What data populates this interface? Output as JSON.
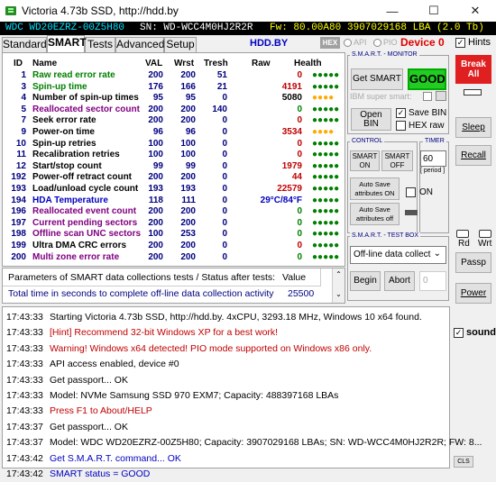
{
  "window": {
    "title": "Victoria 4.73b SSD, http://hdd.by",
    "min": "—",
    "max": "☐",
    "close": "✕"
  },
  "infobar": {
    "model": "WDC WD20EZRZ-00Z5H80",
    "sn": "SN: WD-WCC4M0HJ2R2R",
    "fw": "Fw: 80.00A80",
    "lba": "3907029168 LBA (2.0 Tb)"
  },
  "tabs": [
    "Standard",
    "SMART",
    "Tests",
    "Advanced",
    "Setup"
  ],
  "toolbar": {
    "hdd_by": "HDD.BY",
    "hex": "HEX",
    "api": "API",
    "pio": "PIO",
    "device": "Device 0",
    "hints": "Hints"
  },
  "smart_headers": {
    "id": "ID",
    "name": "Name",
    "val": "VAL",
    "wrst": "Wrst",
    "tresh": "Tresh",
    "raw": "Raw",
    "health": "Health"
  },
  "smart_rows": [
    {
      "id": "1",
      "name": "Raw read error rate",
      "val": "200",
      "wrst": "200",
      "tresh": "51",
      "raw": "0",
      "health": "●●●●●",
      "name_color": "#008000",
      "raw_color": "#c00000",
      "health_color": "#008000"
    },
    {
      "id": "3",
      "name": "Spin-up time",
      "val": "176",
      "wrst": "166",
      "tresh": "21",
      "raw": "4191",
      "health": "●●●●●",
      "name_color": "#008000",
      "raw_color": "#c00000",
      "health_color": "#008000"
    },
    {
      "id": "4",
      "name": "Number of spin-up times",
      "val": "95",
      "wrst": "95",
      "tresh": "0",
      "raw": "5080",
      "health": "●●●●",
      "name_color": "#000000",
      "raw_color": "#000000",
      "health_color": "#ffaa00"
    },
    {
      "id": "5",
      "name": "Reallocated sector count",
      "val": "200",
      "wrst": "200",
      "tresh": "140",
      "raw": "0",
      "health": "●●●●●",
      "name_color": "#800080",
      "raw_color": "#008000",
      "health_color": "#008000"
    },
    {
      "id": "7",
      "name": "Seek error rate",
      "val": "200",
      "wrst": "200",
      "tresh": "0",
      "raw": "0",
      "health": "●●●●●",
      "name_color": "#000000",
      "raw_color": "#c00000",
      "health_color": "#008000"
    },
    {
      "id": "9",
      "name": "Power-on time",
      "val": "96",
      "wrst": "96",
      "tresh": "0",
      "raw": "3534",
      "health": "●●●●",
      "name_color": "#000000",
      "raw_color": "#c00000",
      "health_color": "#ffaa00"
    },
    {
      "id": "10",
      "name": "Spin-up retries",
      "val": "100",
      "wrst": "100",
      "tresh": "0",
      "raw": "0",
      "health": "●●●●●",
      "name_color": "#000000",
      "raw_color": "#c00000",
      "health_color": "#008000"
    },
    {
      "id": "11",
      "name": "Recalibration retries",
      "val": "100",
      "wrst": "100",
      "tresh": "0",
      "raw": "0",
      "health": "●●●●●",
      "name_color": "#000000",
      "raw_color": "#c00000",
      "health_color": "#008000"
    },
    {
      "id": "12",
      "name": "Start/stop count",
      "val": "99",
      "wrst": "99",
      "tresh": "0",
      "raw": "1979",
      "health": "●●●●●",
      "name_color": "#000000",
      "raw_color": "#c00000",
      "health_color": "#008000"
    },
    {
      "id": "192",
      "name": "Power-off retract count",
      "val": "200",
      "wrst": "200",
      "tresh": "0",
      "raw": "44",
      "health": "●●●●●",
      "name_color": "#000000",
      "raw_color": "#c00000",
      "health_color": "#008000"
    },
    {
      "id": "193",
      "name": "Load/unload cycle count",
      "val": "193",
      "wrst": "193",
      "tresh": "0",
      "raw": "22579",
      "health": "●●●●●",
      "name_color": "#000000",
      "raw_color": "#c00000",
      "health_color": "#008000"
    },
    {
      "id": "194",
      "name": "HDA Temperature",
      "val": "118",
      "wrst": "111",
      "tresh": "0",
      "raw": "29°C/84°F",
      "health": "●●●●●",
      "name_color": "#0000c0",
      "raw_color": "#0000c0",
      "health_color": "#008000"
    },
    {
      "id": "196",
      "name": "Reallocated event count",
      "val": "200",
      "wrst": "200",
      "tresh": "0",
      "raw": "0",
      "health": "●●●●●",
      "name_color": "#800080",
      "raw_color": "#008000",
      "health_color": "#008000"
    },
    {
      "id": "197",
      "name": "Current pending sectors",
      "val": "200",
      "wrst": "200",
      "tresh": "0",
      "raw": "0",
      "health": "●●●●●",
      "name_color": "#800080",
      "raw_color": "#008000",
      "health_color": "#008000"
    },
    {
      "id": "198",
      "name": "Offline scan UNC sectors",
      "val": "100",
      "wrst": "253",
      "tresh": "0",
      "raw": "0",
      "health": "●●●●●",
      "name_color": "#800080",
      "raw_color": "#008000",
      "health_color": "#008000"
    },
    {
      "id": "199",
      "name": "Ultra DMA CRC errors",
      "val": "200",
      "wrst": "200",
      "tresh": "0",
      "raw": "0",
      "health": "●●●●●",
      "name_color": "#000000",
      "raw_color": "#c00000",
      "health_color": "#008000"
    },
    {
      "id": "200",
      "name": "Multi zone error rate",
      "val": "200",
      "wrst": "200",
      "tresh": "0",
      "raw": "0",
      "health": "●●●●●",
      "name_color": "#800080",
      "raw_color": "#008000",
      "health_color": "#008000"
    }
  ],
  "params": {
    "header": "Parameters of SMART data collections tests / Status after tests:",
    "value_header": "Value",
    "row_label": "Total time in seconds to complete off-line data collection activity",
    "row_value": "25500"
  },
  "monitor": {
    "title": "S.M.A.R.T. - MONITOR",
    "get_smart": "Get SMART",
    "status": "GOOD",
    "ibm_label": "IBM super smart:",
    "open_bin": "Open BIN",
    "save_bin": "Save BIN",
    "hex_raw": "HEX raw"
  },
  "control": {
    "title": "CONTROL",
    "timer_title": "TIMER",
    "smart_on": "SMART ON",
    "smart_off": "SMART OFF",
    "timer_value": "60",
    "period": "[ period ]",
    "autosave_on": "Auto Save attributes ON",
    "on_label": "ON",
    "autosave_off": "Auto Save attributes off"
  },
  "testbox": {
    "title": "S.M.A.R.T. - TEST BOX",
    "select": "Off-line data collect",
    "begin": "Begin",
    "abort": "Abort",
    "count": "0"
  },
  "sidebar": {
    "break": "Break All",
    "sleep": "Sleep",
    "recall": "Recall",
    "rd": "Rd",
    "wrt": "Wrt",
    "passp": "Passp",
    "power": "Power",
    "sound": "sound",
    "cls": "CLS"
  },
  "log": [
    {
      "time": "17:43:33",
      "msg": "Starting Victoria 4.73b SSD, http://hdd.by. 4xCPU, 3293.18 MHz, Windows 10 x64 found.",
      "color": "#000000"
    },
    {
      "time": "17:43:33",
      "msg": "[Hint] Recommend 32-bit Windows XP for a best work!",
      "color": "#c00000"
    },
    {
      "time": "17:43:33",
      "msg": "Warning! Windows x64 detected! PIO mode supported on Windows x86 only.",
      "color": "#c00000"
    },
    {
      "time": "17:43:33",
      "msg": "API access enabled, device #0",
      "color": "#000000"
    },
    {
      "time": "17:43:33",
      "msg": "Get passport... OK",
      "color": "#000000"
    },
    {
      "time": "17:43:33",
      "msg": "Model: NVMe    Samsung SSD 970 EXM7; Capacity: 488397168 LBAs",
      "color": "#000000"
    },
    {
      "time": "17:43:33",
      "msg": "Press F1 to About/HELP",
      "color": "#c00000"
    },
    {
      "time": "17:43:37",
      "msg": "Get passport... OK",
      "color": "#000000"
    },
    {
      "time": "17:43:37",
      "msg": "Model: WDC WD20EZRZ-00Z5H80; Capacity: 3907029168 LBAs; SN: WD-WCC4M0HJ2R2R; FW: 8...",
      "color": "#000000"
    },
    {
      "time": "17:43:42",
      "msg": "Get S.M.A.R.T. command... OK",
      "color": "#0000c0"
    },
    {
      "time": "17:43:42",
      "msg": "SMART status = GOOD",
      "color": "#0000c0"
    }
  ]
}
